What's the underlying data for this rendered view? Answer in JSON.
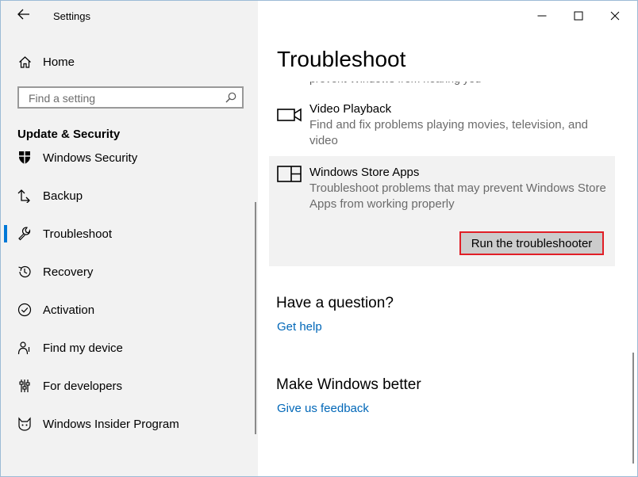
{
  "window": {
    "title": "Settings"
  },
  "sidebar": {
    "home_label": "Home",
    "search_placeholder": "Find a setting",
    "section_title": "Update & Security",
    "items": [
      {
        "label": "Windows Security",
        "icon": "shield-icon"
      },
      {
        "label": "Backup",
        "icon": "backup-arrow-icon"
      },
      {
        "label": "Troubleshoot",
        "icon": "wrench-icon",
        "selected": true
      },
      {
        "label": "Recovery",
        "icon": "history-icon"
      },
      {
        "label": "Activation",
        "icon": "check-circle-icon"
      },
      {
        "label": "Find my device",
        "icon": "person-pin-icon"
      },
      {
        "label": "For developers",
        "icon": "developer-sliders-icon"
      },
      {
        "label": "Windows Insider Program",
        "icon": "insider-cat-icon"
      }
    ]
  },
  "main": {
    "title": "Troubleshoot",
    "cut_off_text": "prevent Windows from hearing you",
    "items": [
      {
        "name": "Video Playback",
        "description": "Find and fix problems playing movies, television, and video",
        "icon": "video-camera-icon"
      },
      {
        "name": "Windows Store Apps",
        "description": "Troubleshoot problems that may prevent Windows Store Apps from working properly",
        "icon": "store-apps-icon",
        "selected": true,
        "button_label": "Run the troubleshooter"
      }
    ],
    "question": {
      "heading": "Have a question?",
      "link": "Get help"
    },
    "feedback": {
      "heading": "Make Windows better",
      "link": "Give us feedback"
    }
  },
  "colors": {
    "accent": "#0078d7",
    "link": "#0067b8",
    "highlight_border": "#e11e26",
    "sidebar_bg": "#f2f2f2"
  }
}
